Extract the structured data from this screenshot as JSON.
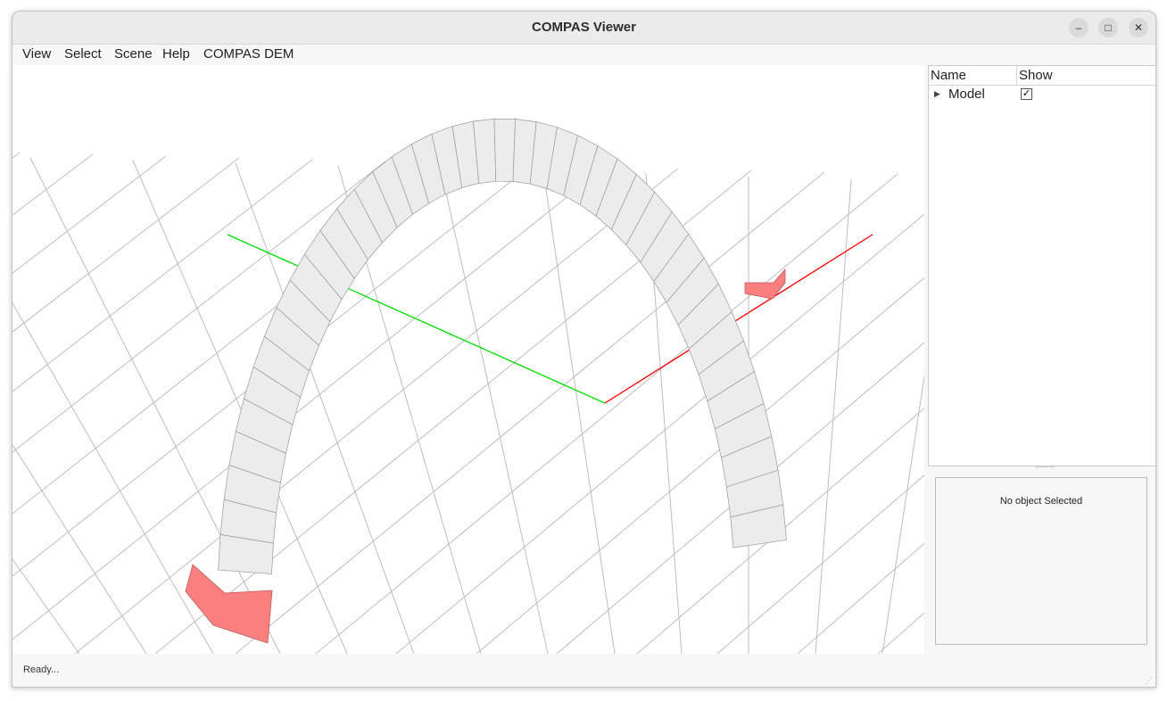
{
  "window": {
    "title": "COMPAS Viewer"
  },
  "titlebar": {
    "minimize_icon": "minimize-icon",
    "maximize_icon": "maximize-icon",
    "close_icon": "close-icon"
  },
  "menu": {
    "items": [
      "View",
      "Select",
      "Scene",
      "Help",
      "COMPAS DEM"
    ]
  },
  "scene_tree": {
    "columns": [
      "Name",
      "Show"
    ],
    "rows": [
      {
        "name": "Model",
        "show": true,
        "expander": "triangle-right"
      }
    ]
  },
  "properties": {
    "text": "No object Selected"
  },
  "status": {
    "text": "Ready..."
  },
  "scene": {
    "x_axis_color": "#ff0000",
    "y_axis_color": "#00dd00",
    "support_color": "#fa8080",
    "block_color": "#ececec"
  }
}
